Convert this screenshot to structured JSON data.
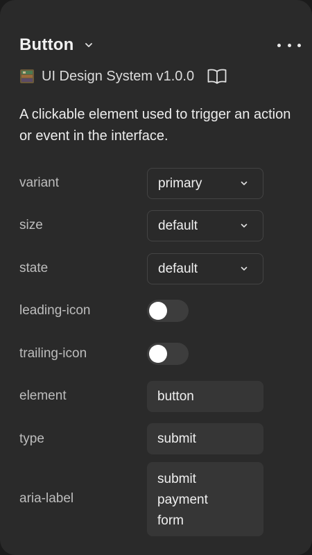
{
  "component": {
    "title": "Button",
    "library": "UI Design System v1.0.0",
    "description": "A clickable element used to trigger an action or event in the interface."
  },
  "props": {
    "variant": {
      "label": "variant",
      "value": "primary"
    },
    "size": {
      "label": "size",
      "value": "default"
    },
    "state": {
      "label": "state",
      "value": "default"
    },
    "leading_icon": {
      "label": "leading-icon",
      "enabled": false
    },
    "trailing_icon": {
      "label": "trailing-icon",
      "enabled": false
    },
    "element": {
      "label": "element",
      "value": "button"
    },
    "type": {
      "label": "type",
      "value": "submit"
    },
    "aria_label": {
      "label": "aria-label",
      "value": "submit\npayment\nform"
    }
  },
  "icons": {
    "title_dropdown": "chevron-down-icon",
    "more": "more-horizontal-icon",
    "library": "library-thumbnail-icon",
    "docs": "open-book-icon",
    "select": "chevron-down-icon"
  },
  "colors": {
    "panel_bg": "#2a2a2a",
    "field_bg": "#363636",
    "toggle_off": "#3d3d3d",
    "text": "#ececec",
    "label": "#bdbdbd"
  }
}
